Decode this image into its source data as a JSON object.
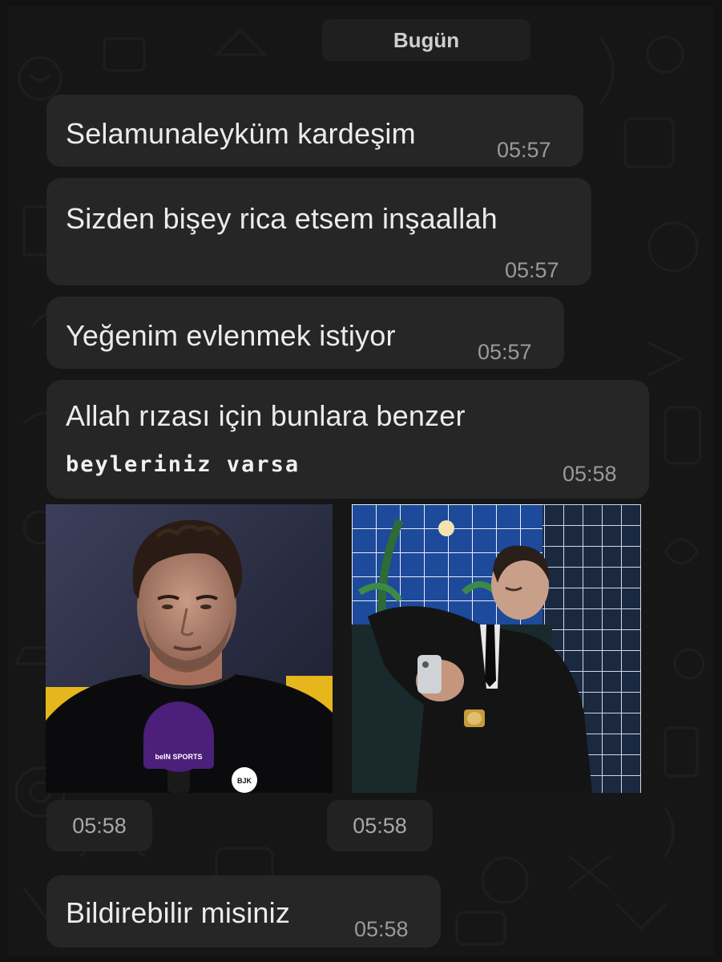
{
  "chat": {
    "date_separator": "Bugün",
    "messages": [
      {
        "text": "Selamunaleyküm kardeşim",
        "time": "05:57"
      },
      {
        "text": "Sizden bişey rica etsem inşaallah",
        "time": "05:57"
      },
      {
        "text": "Yeğenim evlenmek istiyor",
        "time": "05:57"
      },
      {
        "text": "Allah rızası için bunlara benzer",
        "text2": "beyleriniz varsa",
        "time": "05:58"
      },
      {
        "text": "Bildirebilir misiniz",
        "time": "05:58"
      }
    ],
    "images": [
      {
        "time": "05:58",
        "microphone_label": "beIN SPORTS",
        "badge_text": "BJK"
      },
      {
        "time": "05:58"
      }
    ]
  },
  "colors": {
    "background": "#161616",
    "bubble": "#262626",
    "text": "#ececec",
    "time": "#9a9a9a"
  }
}
